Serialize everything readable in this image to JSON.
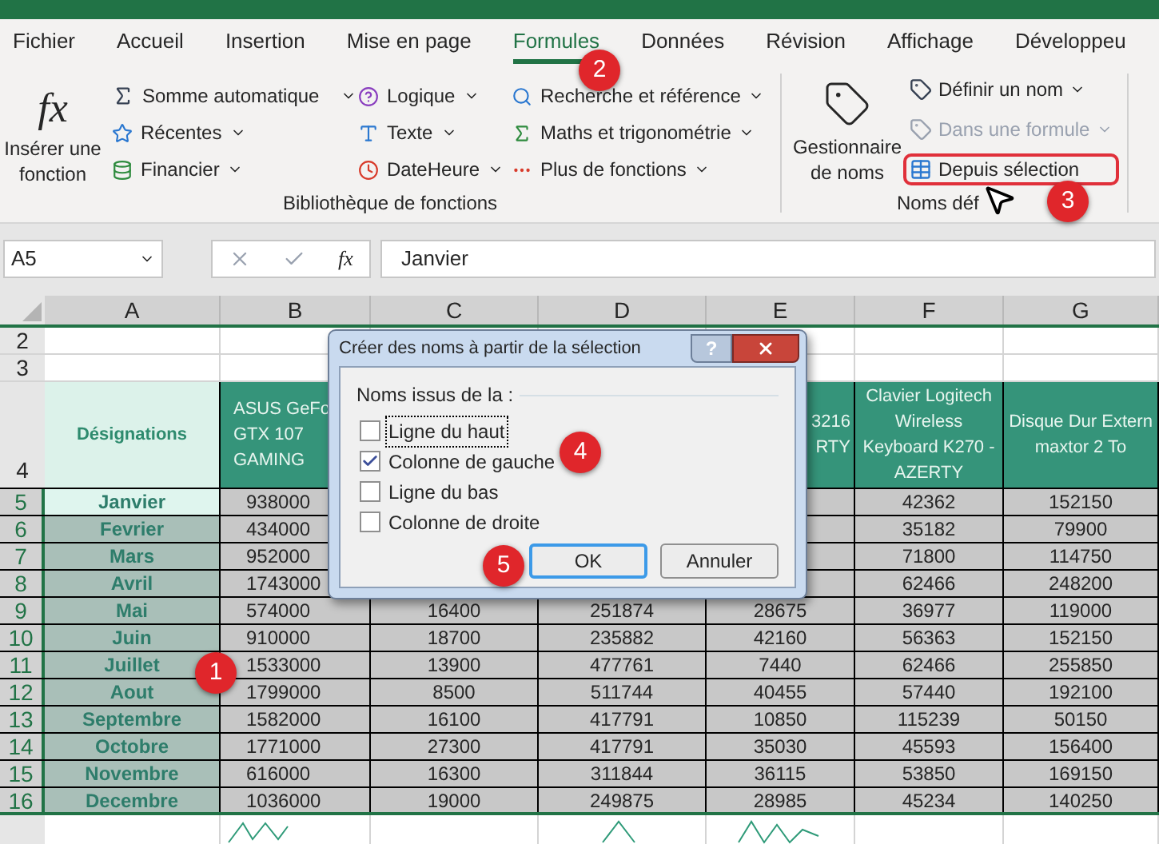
{
  "tabs": [
    {
      "label": "Fichier",
      "selected": false
    },
    {
      "label": "Accueil",
      "selected": false
    },
    {
      "label": "Insertion",
      "selected": false
    },
    {
      "label": "Mise en page",
      "selected": false
    },
    {
      "label": "Formules",
      "selected": true
    },
    {
      "label": "Données",
      "selected": false
    },
    {
      "label": "Révision",
      "selected": false
    },
    {
      "label": "Affichage",
      "selected": false
    },
    {
      "label": "Développeu",
      "selected": false
    }
  ],
  "library": {
    "insert_function": {
      "icon_text": "fx",
      "label_lines": [
        "Insérer une",
        "fonction"
      ]
    },
    "columns": [
      [
        {
          "label": "Somme automatique",
          "dropdown": true
        },
        {
          "label": "Récentes",
          "dropdown": true
        },
        {
          "label": "Financier",
          "dropdown": true
        }
      ],
      [
        {
          "label": "Logique",
          "dropdown": true
        },
        {
          "label": "Texte",
          "dropdown": true
        },
        {
          "label": "DateHeure",
          "dropdown": true
        }
      ],
      [
        {
          "label": "Recherche et référence",
          "dropdown": true
        },
        {
          "label": "Maths et trigonométrie",
          "dropdown": true
        },
        {
          "label": "Plus de fonctions",
          "dropdown": true
        }
      ]
    ],
    "group_label": "Bibliothèque de fonctions"
  },
  "names": {
    "manager_lines": [
      "Gestionnaire",
      "de noms"
    ],
    "items": [
      {
        "label": "Définir un nom",
        "dropdown": true,
        "disabled": false,
        "highlighted": false
      },
      {
        "label": "Dans une formule",
        "dropdown": true,
        "disabled": true,
        "highlighted": false
      },
      {
        "label": "Depuis sélection",
        "dropdown": false,
        "disabled": false,
        "highlighted": true
      }
    ],
    "group_label": "Noms déf"
  },
  "formula_bar": {
    "name_box": "A5",
    "fx": "fx",
    "value": "Janvier"
  },
  "sheet": {
    "columns": [
      "A",
      "B",
      "C",
      "D",
      "E",
      "F",
      "G"
    ],
    "empty_rows": [
      "2",
      "3"
    ],
    "header": {
      "number": "4",
      "cells": [
        {
          "lines": [
            "Désignations"
          ]
        },
        {
          "lines": [
            "ASUS GeFo",
            "GTX 107",
            "GAMING"
          ]
        },
        null,
        null,
        {
          "lines": [
            "3216",
            "RTY"
          ]
        },
        {
          "lines": [
            "Clavier Logitech",
            "Wireless",
            "Keyboard K270 -",
            "AZERTY"
          ]
        },
        {
          "lines": [
            "Disque Dur Extern",
            "maxtor 2 To"
          ]
        }
      ]
    },
    "rows": [
      {
        "number": "5",
        "active": true,
        "cells": [
          "Janvier",
          "938000",
          null,
          null,
          null,
          "42362",
          "152150"
        ]
      },
      {
        "number": "6",
        "active": false,
        "cells": [
          "Fevrier",
          "434000",
          null,
          null,
          null,
          "35182",
          "79900"
        ]
      },
      {
        "number": "7",
        "active": false,
        "cells": [
          "Mars",
          "952000",
          null,
          null,
          null,
          "71800",
          "114750"
        ]
      },
      {
        "number": "8",
        "active": false,
        "cells": [
          "Avril",
          "1743000",
          null,
          null,
          null,
          "62466",
          "248200"
        ]
      },
      {
        "number": "9",
        "active": false,
        "cells": [
          "Mai",
          "574000",
          "16400",
          "251874",
          "28675",
          "36977",
          "119000"
        ]
      },
      {
        "number": "10",
        "active": false,
        "cells": [
          "Juin",
          "910000",
          "18700",
          "235882",
          "42160",
          "56363",
          "152150"
        ]
      },
      {
        "number": "11",
        "active": false,
        "cells": [
          "Juillet",
          "1533000",
          "13900",
          "477761",
          "7440",
          "62466",
          "255850"
        ]
      },
      {
        "number": "12",
        "active": false,
        "cells": [
          "Aout",
          "1799000",
          "8500",
          "511744",
          "40455",
          "57440",
          "192100"
        ]
      },
      {
        "number": "13",
        "active": false,
        "cells": [
          "Septembre",
          "1582000",
          "16100",
          "417791",
          "10850",
          "115239",
          "50150"
        ]
      },
      {
        "number": "14",
        "active": false,
        "cells": [
          "Octobre",
          "1771000",
          "27300",
          "417791",
          "35030",
          "45593",
          "156400"
        ]
      },
      {
        "number": "15",
        "active": false,
        "cells": [
          "Novembre",
          "616000",
          "16300",
          "311844",
          "36115",
          "53850",
          "169150"
        ]
      },
      {
        "number": "16",
        "active": false,
        "cells": [
          "Decembre",
          "1036000",
          "19000",
          "249875",
          "28985",
          "45234",
          "140250"
        ]
      }
    ]
  },
  "dialog": {
    "title": "Créer des noms à partir de la sélection",
    "help": "?",
    "group_label": "Noms issus de la :",
    "options": [
      {
        "label": "Ligne du haut",
        "checked": false,
        "focused": true
      },
      {
        "label": "Colonne de gauche",
        "checked": true,
        "focused": false
      },
      {
        "label": "Ligne du bas",
        "checked": false,
        "focused": false
      },
      {
        "label": "Colonne de droite",
        "checked": false,
        "focused": false
      }
    ],
    "buttons": [
      {
        "label": "OK",
        "default": true
      },
      {
        "label": "Annuler",
        "default": false
      }
    ]
  },
  "callouts": [
    {
      "label": "1"
    },
    {
      "label": "2"
    },
    {
      "label": "3"
    },
    {
      "label": "4"
    },
    {
      "label": "5"
    }
  ]
}
